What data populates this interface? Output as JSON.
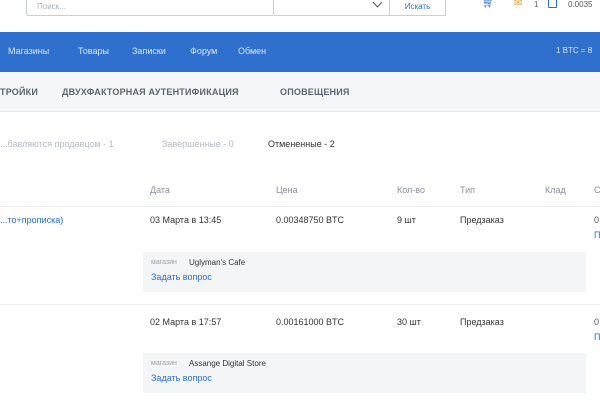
{
  "search": {
    "placeholder": "Поиск...",
    "button": "Искать"
  },
  "header": {
    "mail_count": "1",
    "balance": "0.0035",
    "rate": "1 BTC = 8"
  },
  "nav": [
    "Магазины",
    "Товары",
    "Записки",
    "Форум",
    "Обмен"
  ],
  "tabs": [
    "ТРОЙКИ",
    "ДВУХФАКТОРНАЯ АУТЕНТИФИКАЦИЯ",
    "ОПОВЕЩЕНИЯ"
  ],
  "filters": [
    "...бавляются продавцом - 1",
    "Завершенные - 0",
    "Отмененные - 2"
  ],
  "table": {
    "headers": [
      "Дата",
      "Цена",
      "Кол-во",
      "Тип",
      "Клад",
      "С"
    ],
    "shop_label": "магазин",
    "ask_label": "Задать вопрос",
    "rows": [
      {
        "product": "...то+прописка)",
        "date": "03 Марта в 13:45",
        "price": "0.00348750 BTC",
        "qty": "9 шт",
        "type": "Предзаказ",
        "edge_top": "0",
        "edge_bottom": "П",
        "shop": "Uglyman's Cafe"
      },
      {
        "product": "",
        "date": "02 Марта в 17:57",
        "price": "0.00161000 BTC",
        "qty": "30 шт",
        "type": "Предзаказ",
        "edge_top": "0",
        "edge_bottom": "П",
        "shop": "Assange Digital Store"
      }
    ]
  }
}
